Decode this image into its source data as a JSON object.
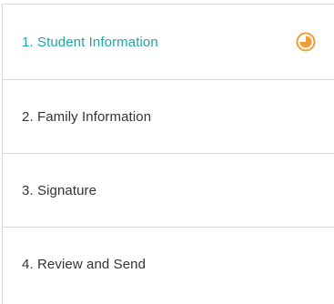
{
  "steps": [
    {
      "label": "1. Student Information",
      "active": true,
      "status_icon": "in-progress-icon"
    },
    {
      "label": "2. Family Information",
      "active": false
    },
    {
      "label": "3. Signature",
      "active": false
    },
    {
      "label": "4. Review and Send",
      "active": false
    }
  ],
  "colors": {
    "active_text": "#1fa7a4",
    "inactive_text": "#333333",
    "status_orange": "#f39a36",
    "divider": "#d9d9d9"
  }
}
